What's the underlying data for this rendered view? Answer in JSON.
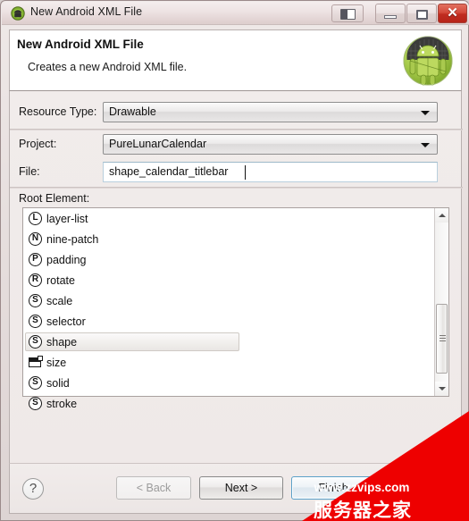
{
  "window": {
    "title": "New Android XML File",
    "icon": "android-small-icon",
    "controls": {
      "panel_toggle": "panel-toggle-icon",
      "minimize": "minimize-icon",
      "maximize": "maximize-icon",
      "close": "✕"
    }
  },
  "header": {
    "title": "New Android XML File",
    "subtitle": "Creates a new Android XML file.",
    "badge_icon": "android-robot-icon"
  },
  "form": {
    "resource_type": {
      "label": "Resource Type:",
      "value": "Drawable"
    },
    "project": {
      "label": "Project:",
      "value": "PureLunarCalendar"
    },
    "file": {
      "label": "File:",
      "value": "shape_calendar_titlebar",
      "placeholder": ""
    },
    "root_element": {
      "label": "Root Element:",
      "items": [
        {
          "label": "layer-list",
          "icon": "L",
          "icon_type": "circle-letter",
          "selected": false
        },
        {
          "label": "nine-patch",
          "icon": "N",
          "icon_type": "circle-letter",
          "selected": false
        },
        {
          "label": "padding",
          "icon": "P",
          "icon_type": "circle-letter",
          "selected": false
        },
        {
          "label": "rotate",
          "icon": "R",
          "icon_type": "circle-letter",
          "selected": false
        },
        {
          "label": "scale",
          "icon": "S",
          "icon_type": "circle-letter",
          "selected": false
        },
        {
          "label": "selector",
          "icon": "S",
          "icon_type": "circle-letter",
          "selected": false
        },
        {
          "label": "shape",
          "icon": "S",
          "icon_type": "circle-letter",
          "selected": true
        },
        {
          "label": "size",
          "icon": "",
          "icon_type": "panel-glyph",
          "selected": false
        },
        {
          "label": "solid",
          "icon": "S",
          "icon_type": "circle-letter",
          "selected": false
        },
        {
          "label": "stroke",
          "icon": "S",
          "icon_type": "circle-letter",
          "selected": false
        }
      ]
    }
  },
  "footer": {
    "help": "?",
    "back": "< Back",
    "next": "Next >",
    "finish": "Finish"
  },
  "watermark": {
    "url": "www.zzvips.com",
    "cn": "服务器之家",
    "color": "#ee0000"
  }
}
